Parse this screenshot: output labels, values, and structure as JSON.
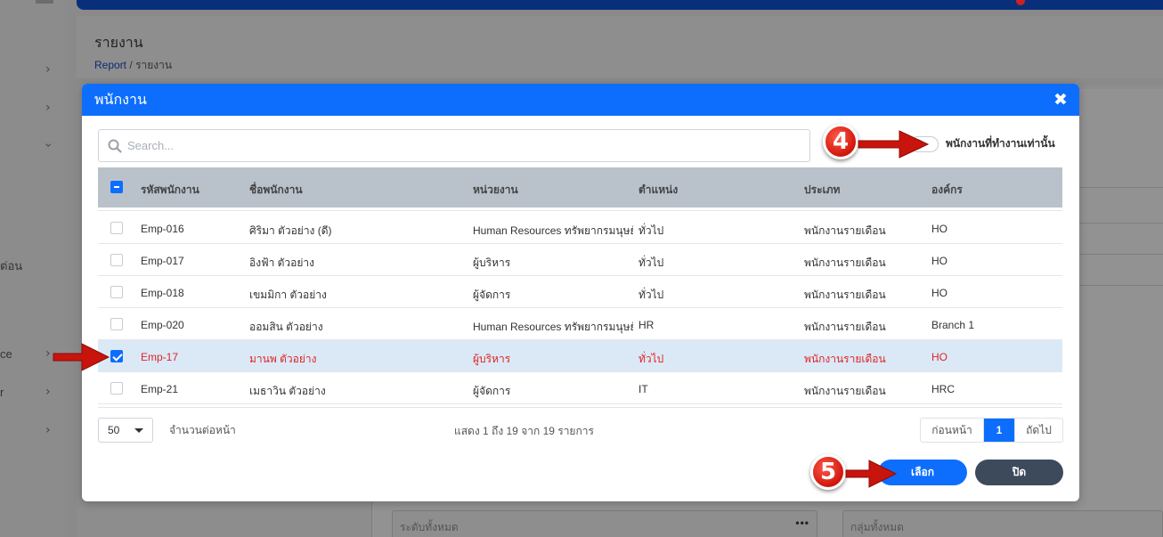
{
  "background": {
    "sidebar_fragments": [
      "ต่อน",
      "ce",
      "r"
    ],
    "page_title": "รายงาน",
    "breadcrumb": {
      "root": "Report",
      "separator": "/",
      "current": "รายงาน"
    },
    "field_all_levels": "ระดับทั้งหมด",
    "field_all_groups": "กลุ่มทั้งหมด",
    "field_dots": "•••"
  },
  "modal": {
    "title": "พนักงาน",
    "close_icon": "close-icon",
    "search": {
      "placeholder": "Search..."
    },
    "active_only_toggle": {
      "label": "พนักงานที่ทำงานเท่านั้น",
      "on": false
    },
    "table": {
      "headers": [
        "รหัสพนักงาน",
        "ชื่อพนักงาน",
        "หน่วยงาน",
        "ตำแหน่ง",
        "ประเภท",
        "องค์กร"
      ],
      "rows": [
        {
          "checked": false,
          "cells": [
            "Emp-016",
            "ศิริมา ตัวอย่าง (ดี)",
            "Human Resources ทรัพยากรมนุษย์",
            "ทั่วไป",
            "พนักงานรายเดือน",
            "HO"
          ]
        },
        {
          "checked": false,
          "cells": [
            "Emp-017",
            "อิงฟ้า ตัวอย่าง",
            "ผู้บริหาร",
            "ทั่วไป",
            "พนักงานรายเดือน",
            "HO"
          ]
        },
        {
          "checked": false,
          "cells": [
            "Emp-018",
            "เขมมิกา ตัวอย่าง",
            "ผู้จัดการ",
            "ทั่วไป",
            "พนักงานรายเดือน",
            "HO"
          ]
        },
        {
          "checked": false,
          "cells": [
            "Emp-020",
            "ออมสิน ตัวอย่าง",
            "Human Resources ทรัพยากรมนุษย์",
            "HR",
            "พนักงานรายเดือน",
            "Branch 1"
          ]
        },
        {
          "checked": true,
          "cells": [
            "Emp-17",
            "มานพ ตัวอย่าง",
            "ผู้บริหาร",
            "ทั่วไป",
            "พนักงานรายเดือน",
            "HO"
          ]
        },
        {
          "checked": false,
          "cells": [
            "Emp-21",
            "เมธาวิน ตัวอย่าง",
            "ผู้จัดการ",
            "IT",
            "พนักงานรายเดือน",
            "HRC"
          ]
        }
      ]
    },
    "page_size": "50",
    "per_page_label": "จำนวนต่อหน้า",
    "showing_text": "แสดง 1 ถึง 19 จาก 19 รายการ",
    "pagination": {
      "prev": "ก่อนหน้า",
      "current": "1",
      "next": "ถัดไป"
    },
    "buttons": {
      "select": "เลือก",
      "close": "ปิด"
    }
  },
  "annotations": {
    "step_4": "4",
    "step_5": "5"
  },
  "colors": {
    "primary": "#0d6efd",
    "header_bg": "#b9c2cb",
    "selected_row_bg": "#dbe9f7",
    "selected_text": "#e02424",
    "close_btn": "#3d4a5c",
    "annotation_red": "#d0160b"
  }
}
